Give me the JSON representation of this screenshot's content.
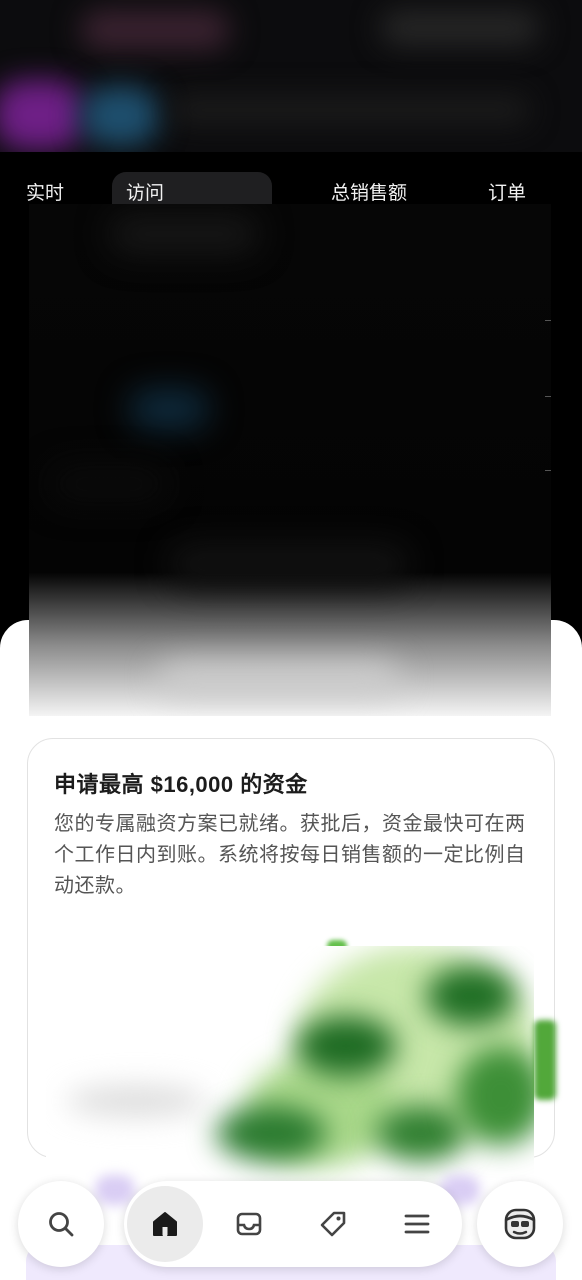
{
  "metrics_tabs": [
    {
      "label": "实时"
    },
    {
      "label": "访问"
    },
    {
      "label": "总销售额"
    },
    {
      "label": "订单"
    }
  ],
  "funding_card": {
    "title": "申请最高 $16,000 的资金",
    "body": "您的专属融资方案已就绪。获批后，资金最快可在两个工作日内到账。系统将按每日销售额的一定比例自动还款。"
  },
  "bottom_nav": {
    "items": [
      {
        "icon": "search-icon"
      },
      {
        "icon": "home-icon",
        "active": true
      },
      {
        "icon": "inbox-icon"
      },
      {
        "icon": "tag-icon"
      },
      {
        "icon": "menu-icon"
      },
      {
        "icon": "avatar-icon"
      }
    ]
  },
  "colors": {
    "background_dark": "#000000",
    "sheet": "#ffffff",
    "text_dark": "#1c1c1c",
    "text_muted": "#555555",
    "accent_purple": "#d9cdf4",
    "illustration_green": "#2a7a2f"
  }
}
